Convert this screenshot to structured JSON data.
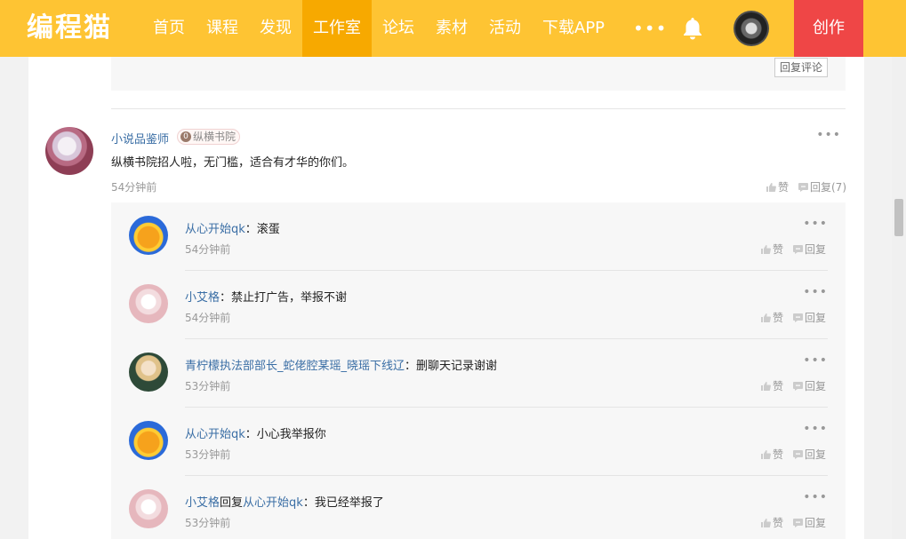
{
  "header": {
    "logo": "编程猫",
    "nav": [
      "首页",
      "课程",
      "发现",
      "工作室",
      "论坛",
      "素材",
      "活动",
      "下载APP"
    ],
    "active_nav": 3,
    "more": "•••",
    "create_label": "创作"
  },
  "prev": {
    "reply_comment_label": "回复评论"
  },
  "comment": {
    "user": "小说品鉴师",
    "badge_icon": "0",
    "badge": "纵横书院",
    "text": "纵横书院招人啦，无门槛，适合有才华的你们。",
    "time": "54分钟前",
    "like_label": "赞",
    "reply_label": "回复(7)",
    "more": "•••"
  },
  "replies": [
    {
      "name": "从心开始qk",
      "reply_word": "",
      "target": "",
      "text": "：滚蛋",
      "time": "54分钟前",
      "avatar": "monkey-avatar"
    },
    {
      "name": "小艾格",
      "reply_word": "",
      "target": "",
      "text": "：禁止打广告，举报不谢",
      "time": "54分钟前",
      "avatar": "girl-avatar"
    },
    {
      "name": "青柠檬执法部部长_蛇佬腔某瑶_晓瑶下线辽",
      "reply_word": "",
      "target": "",
      "text": "：删聊天记录谢谢",
      "time": "53分钟前",
      "avatar": "anime-avatar"
    },
    {
      "name": "从心开始qk",
      "reply_word": "",
      "target": "",
      "text": "：小心我举报你",
      "time": "53分钟前",
      "avatar": "monkey-avatar"
    },
    {
      "name": "小艾格",
      "reply_word": "回复",
      "target": "从心开始qk",
      "text": "：我已经举报了",
      "time": "53分钟前",
      "avatar": "girl-avatar"
    }
  ],
  "reply_actions": {
    "like_label": "赞",
    "reply_label": "回复",
    "more": "•••"
  }
}
